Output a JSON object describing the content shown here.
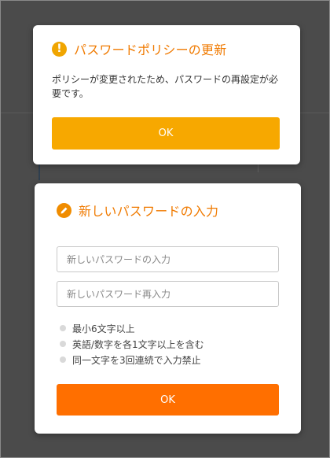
{
  "colors": {
    "backdrop": "#4b4b4b",
    "accent_orange": "#f07a00",
    "button_yellow": "#f7a800",
    "button_orange": "#ff6f00",
    "bullet": "#d9d9d9"
  },
  "policy_dialog": {
    "icon": "warning-icon",
    "icon_glyph": "!",
    "title": "パスワードポリシーの更新",
    "message": "ポリシーが変更されたため、パスワードの再設定が必要です。",
    "ok_label": "OK"
  },
  "new_password_dialog": {
    "icon": "pencil-icon",
    "title": "新しいパスワードの入力",
    "password_input": {
      "value": "",
      "placeholder": "新しいパスワードの入力"
    },
    "confirm_input": {
      "value": "",
      "placeholder": "新しいパスワード再入力"
    },
    "rules": [
      "最小6文字以上",
      "英語/数字を各1文字以上を含む",
      "同一文字を3回連続で入力禁止"
    ],
    "ok_label": "OK"
  }
}
